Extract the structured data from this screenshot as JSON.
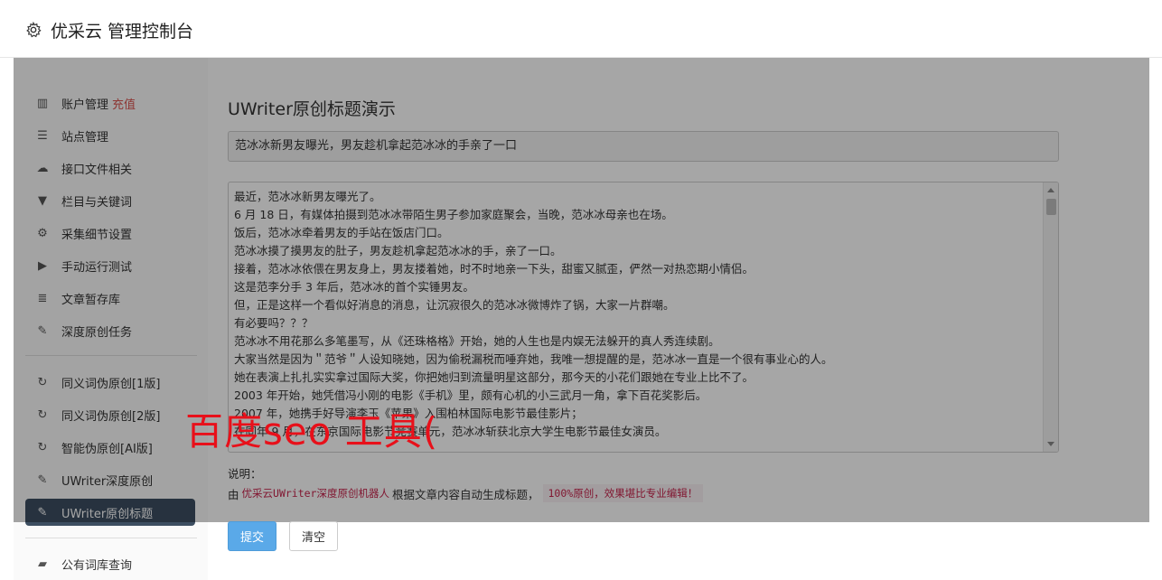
{
  "header": {
    "title": "优采云 管理控制台",
    "icon": "gear-icon"
  },
  "sidebar": {
    "items": [
      {
        "label": "账户管理",
        "extra": "充值",
        "icon": "bar-chart-icon",
        "glyph": "▥"
      },
      {
        "label": "站点管理",
        "icon": "server-icon",
        "glyph": "☰"
      },
      {
        "label": "接口文件相关",
        "icon": "cloud-upload-icon",
        "glyph": "☁"
      },
      {
        "label": "栏目与关键词",
        "icon": "filter-icon",
        "glyph": "▼"
      },
      {
        "label": "采集细节设置",
        "icon": "cogs-icon",
        "glyph": "⚙"
      },
      {
        "label": "手动运行测试",
        "icon": "play-circle-icon",
        "glyph": "▶"
      },
      {
        "label": "文章暂存库",
        "icon": "database-icon",
        "glyph": "≣"
      },
      {
        "label": "深度原创任务",
        "icon": "edit-icon",
        "glyph": "✎"
      },
      {
        "label": "同义词伪原创[1版]",
        "icon": "refresh-icon",
        "glyph": "↻"
      },
      {
        "label": "同义词伪原创[2版]",
        "icon": "refresh-icon",
        "glyph": "↻"
      },
      {
        "label": "智能伪原创[AI版]",
        "icon": "refresh-icon",
        "glyph": "↻"
      },
      {
        "label": "UWriter深度原创",
        "icon": "edit-icon",
        "glyph": "✎"
      },
      {
        "label": "UWriter原创标题",
        "icon": "edit-icon",
        "glyph": "✎",
        "active": true
      },
      {
        "label": "公有词库查询",
        "icon": "book-icon",
        "glyph": "▰"
      }
    ]
  },
  "main": {
    "page_title": "UWriter原创标题演示",
    "title_value": "范冰冰新男友曝光，男友趁机拿起范冰冰的手亲了一口",
    "content_lines": [
      "最近，范冰冰新男友曝光了。",
      "6 月 18 日，有媒体拍摄到范冰冰带陌生男子参加家庭聚会，当晚，范冰冰母亲也在场。",
      "饭后，范冰冰牵着男友的手站在饭店门口。",
      "范冰冰摸了摸男友的肚子，男友趁机拿起范冰冰的手，亲了一口。",
      "接着，范冰冰依偎在男友身上，男友搂着她，时不时地亲一下头，甜蜜又腻歪，俨然一对热恋期小情侣。",
      "这是范李分手 3 年后，范冰冰的首个实锤男友。",
      "但，正是这样一个看似好消息的消息，让沉寂很久的范冰冰微博炸了锅，大家一片群嘲。",
      "有必要吗？？？",
      "范冰冰不用花那么多笔墨写，从《还珠格格》开始，她的人生也是内娱无法躲开的真人秀连续剧。",
      "大家当然是因为＂范爷＂人设知晓她，因为偷税漏税而唾弃她，我唯一想提醒的是，范冰冰一直是一个很有事业心的人。",
      "她在表演上扎扎实实拿过国际大奖，你把她归到流量明星这部分，那今天的小花们跟她在专业上比不了。",
      "2003 年开始，她凭借冯小刚的电影《手机》里，颇有心机的小三武月一角，拿下百花奖影后。",
      "2007 年，她携手好导演李玉《苹果》入围柏林国际电影节最佳影片；",
      "在同年 9 月，在东京国际电影节竞赛单元，范冰冰斩获北京大学生电影节最佳女演员。"
    ],
    "note_label": "说明：",
    "note_prefix": "由",
    "note_code": "优采云UWriter深度原创机器人",
    "note_middle": "根据文章内容自动生成标题，",
    "note_highlight": "100%原创，效果堪比专业编辑！",
    "submit_label": "提交",
    "clear_label": "清空"
  },
  "watermark": "百度seo 工具("
}
